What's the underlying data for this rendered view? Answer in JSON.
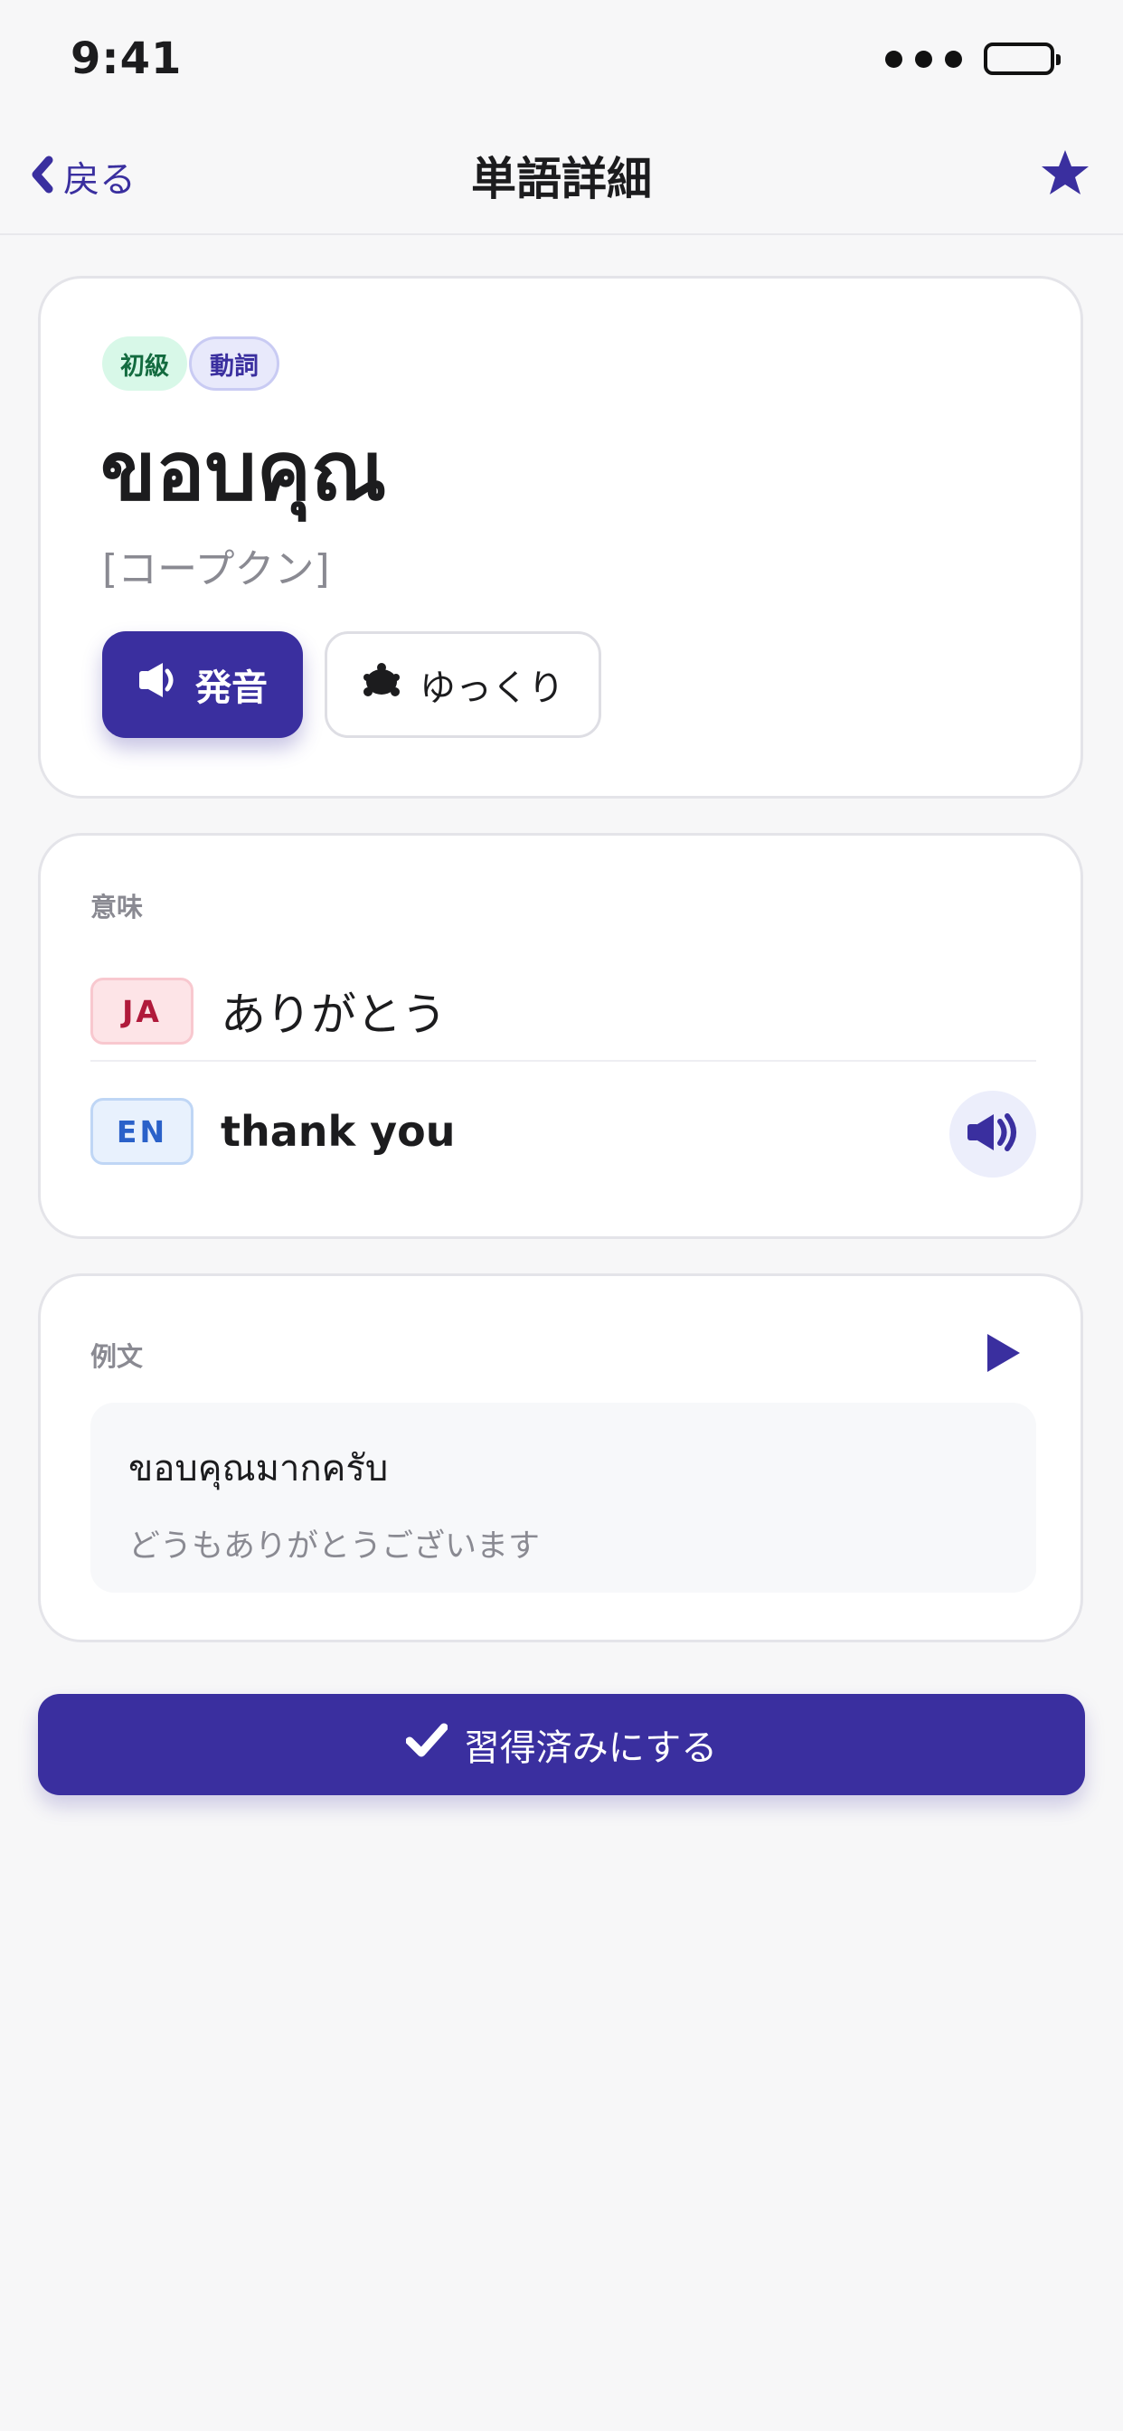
{
  "status_bar": {
    "time": "9:41"
  },
  "nav": {
    "back_label": "戻る",
    "title": "単語詳細"
  },
  "word": {
    "tags": {
      "level": "初級",
      "part_of_speech": "動詞"
    },
    "thai": "ขอบคุณ",
    "reading": "[コープクン]",
    "speak_label": "発音",
    "slow_label": "ゆっくり"
  },
  "meaning": {
    "section_label": "意味",
    "items": [
      {
        "lang": "JA",
        "text": "ありがとう"
      },
      {
        "lang": "EN",
        "text": "thank you"
      }
    ]
  },
  "example": {
    "section_label": "例文",
    "thai": "ขอบคุณมากครับ",
    "japanese": "どうもありがとうございます"
  },
  "action": {
    "mastered_label": "習得済みにする"
  },
  "colors": {
    "accent": "#3a2f9f",
    "background": "#f7f7f8"
  },
  "icons": {
    "back": "chevron-left-icon",
    "favorite": "star-icon",
    "speak": "speaker-icon",
    "slow": "turtle-icon",
    "play": "play-icon",
    "check": "checkmark-icon"
  }
}
